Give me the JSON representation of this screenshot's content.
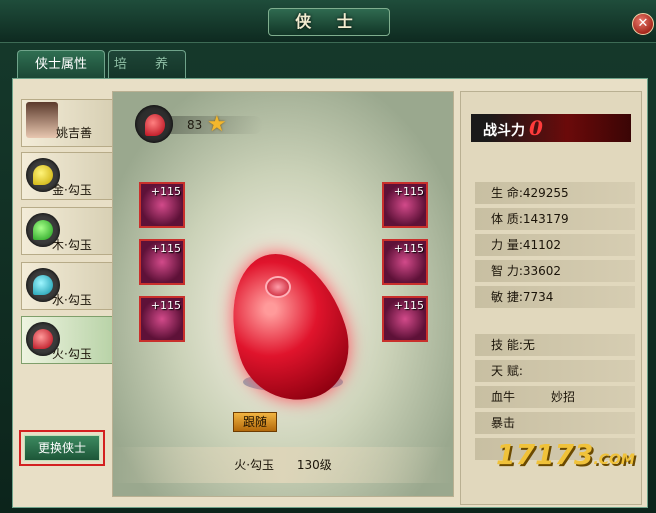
{
  "window": {
    "title": "侠 士",
    "close_icon": "close-icon"
  },
  "tabs": [
    {
      "label": "侠士属性",
      "active": true
    },
    {
      "label": "培 养",
      "active": false
    }
  ],
  "sidebar": {
    "items": [
      {
        "label": "姚吉善",
        "type": "portrait"
      },
      {
        "label": "金·勾玉",
        "color": "#f0d000"
      },
      {
        "label": "木·勾玉",
        "color": "#3ad43a"
      },
      {
        "label": "水·勾玉",
        "color": "#20c8d8"
      },
      {
        "label": "火·勾玉",
        "color": "#e21f2f",
        "selected": true
      }
    ],
    "swap_button": "更换侠士"
  },
  "center": {
    "level": "83",
    "star_icon": "star-icon",
    "equip_bonus": [
      "+115",
      "+115",
      "+115",
      "+115",
      "+115",
      "+115"
    ],
    "follow_button": "跟随",
    "character_name": "火·勾玉",
    "character_level": "130级"
  },
  "right": {
    "power_label": "战斗力",
    "power_value": "0",
    "stats": [
      {
        "label": "生 命:",
        "value": "429255"
      },
      {
        "label": "体 质:",
        "value": "143179"
      },
      {
        "label": "力 量:",
        "value": "41102"
      },
      {
        "label": "智 力:",
        "value": "33602"
      },
      {
        "label": "敏 捷:",
        "value": "7734"
      }
    ],
    "skills": [
      {
        "label": "技 能:",
        "value": "无"
      },
      {
        "label": "天 赋:",
        "value": ""
      },
      {
        "label": "血牛",
        "value": "妙招"
      },
      {
        "label": "暴击",
        "value": ""
      },
      {
        "label": "",
        "value": ""
      }
    ]
  },
  "watermark": {
    "main": "17173",
    "suffix": ".COM"
  },
  "colors": {
    "accent": "#2f6f52",
    "highlight": "#d32020",
    "jade_fire": "#e0142c"
  }
}
